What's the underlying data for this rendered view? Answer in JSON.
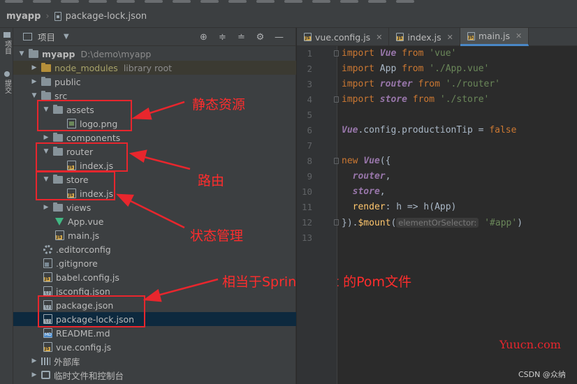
{
  "breadcrumb": {
    "root": "myapp",
    "file": "package-lock.json"
  },
  "left_strip": {
    "project_tab": "项目",
    "commit_tab": "提交"
  },
  "panel": {
    "title": "项目"
  },
  "tree": {
    "root_name": "myapp",
    "root_path": "D:\\demo\\myapp",
    "node_modules": "node_modules",
    "library_root": "library root",
    "public": "public",
    "src": "src",
    "assets": "assets",
    "logo": "logo.png",
    "components": "components",
    "router": "router",
    "router_index": "index.js",
    "store": "store",
    "store_index": "index.js",
    "views": "views",
    "app_vue": "App.vue",
    "main_js": "main.js",
    "editorconfig": ".editorconfig",
    "gitignore": ".gitignore",
    "babel": "babel.config.js",
    "jsconfig": "jsconfig.json",
    "package_json": "package.json",
    "package_lock": "package-lock.json",
    "readme": "README.md",
    "vue_config": "vue.config.js",
    "external_libs": "外部库",
    "scratches": "临时文件和控制台"
  },
  "annotations": {
    "static_resources": "静态资源",
    "routing": "路由",
    "state_management": "状态管理",
    "pom_note": "相当于Spring boot 的Pom文件"
  },
  "tabs": [
    {
      "label": "vue.config.js"
    },
    {
      "label": "index.js"
    },
    {
      "label": "main.js"
    }
  ],
  "line_numbers": [
    "1",
    "2",
    "3",
    "4",
    "5",
    "6",
    "7",
    "8",
    "9",
    "10",
    "11",
    "12",
    "13"
  ],
  "code": {
    "l1": {
      "kw": "import",
      "name": "Vue",
      "from": "from",
      "str": "'vue'"
    },
    "l2": {
      "kw": "import",
      "name": "App",
      "from": "from",
      "str": "'./App.vue'"
    },
    "l3": {
      "kw": "import",
      "name": "router",
      "from": "from",
      "str": "'./router'"
    },
    "l4": {
      "kw": "import",
      "name": "store",
      "from": "from",
      "str": "'./store'"
    },
    "l5": {
      "obj": "Vue",
      "rest": ".config.productionTip = ",
      "val": "false"
    },
    "l8": {
      "kw": "new",
      "cls": "Vue",
      "rest": "({"
    },
    "l9": {
      "prop": "router",
      "rest": ","
    },
    "l10": {
      "prop": "store",
      "rest": ","
    },
    "l11": {
      "prop": "render",
      "rest": ": h => h(App)"
    },
    "l12": {
      "pre": "}).",
      "fn": "$mount",
      "open": "(",
      "hint": "elementOrSelector:",
      "str": "'#app'",
      "close": ")"
    }
  },
  "watermark": "Yuucn.com",
  "csdn": "CSDN @众纳",
  "colors": {
    "annotation_red": "#e8262d",
    "selection": "#0d293e",
    "keyword": "#cc7832",
    "string": "#6a8759"
  }
}
